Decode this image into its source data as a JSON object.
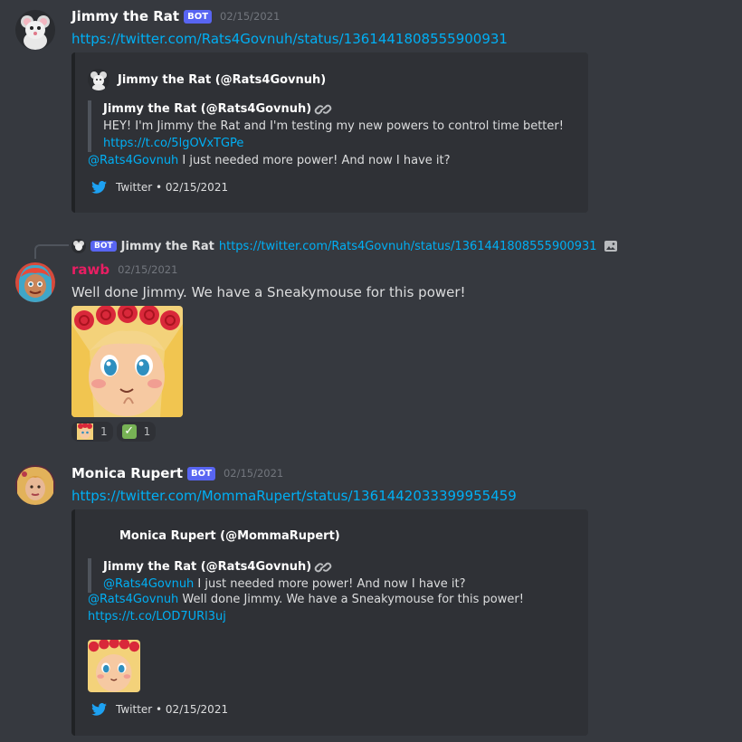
{
  "messages": [
    {
      "username": "Jimmy the Rat",
      "bot_tag": "BOT",
      "timestamp": "02/15/2021",
      "link": "https://twitter.com/Rats4Govnuh/status/1361441808555900931",
      "embed": {
        "author": "Jimmy the Rat (@Rats4Govnuh)",
        "quote_title": "Jimmy the Rat (@Rats4Govnuh)",
        "quote_text": "HEY! I'm Jimmy the Rat and I'm testing my new powers to control time better!",
        "quote_link": "https://t.co/5lgOVxTGPe",
        "reply_mention": "@Rats4Govnuh",
        "reply_text": " I just needed more power! And now I have it?",
        "footer": "Twitter • 02/15/2021"
      }
    },
    {
      "reply": {
        "bot_tag": "BOT",
        "username": "Jimmy the Rat",
        "link": "https://twitter.com/Rats4Govnuh/status/1361441808555900931"
      },
      "username": "rawb",
      "username_color": "#e91e63",
      "timestamp": "02/15/2021",
      "text": "Well done Jimmy. We have a Sneakymouse for this power!",
      "reactions": [
        {
          "icon": "sneakymouse-emoji-icon",
          "count": "1"
        },
        {
          "icon": "checkmark-emoji-icon",
          "count": "1"
        }
      ]
    },
    {
      "username": "Monica Rupert",
      "bot_tag": "BOT",
      "timestamp": "02/15/2021",
      "link": "https://twitter.com/MommaRupert/status/1361442033399955459",
      "embed": {
        "author": "Monica Rupert (@MommaRupert)",
        "quote_title": "Jimmy the Rat (@Rats4Govnuh)",
        "quote_mention": "@Rats4Govnuh",
        "quote_text": " I just needed more power! And now I have it?",
        "reply_mention": "@Rats4Govnuh",
        "reply_text": " Well done Jimmy. We have a Sneakymouse for this power!",
        "link": "https://t.co/LOD7URl3uj",
        "footer": "Twitter • 02/15/2021"
      }
    }
  ],
  "colors": {
    "background": "#36393f",
    "embed_bg": "#2f3136",
    "link": "#00aff4",
    "bot_tag": "#5865f2",
    "twitter": "#1da1f2"
  }
}
